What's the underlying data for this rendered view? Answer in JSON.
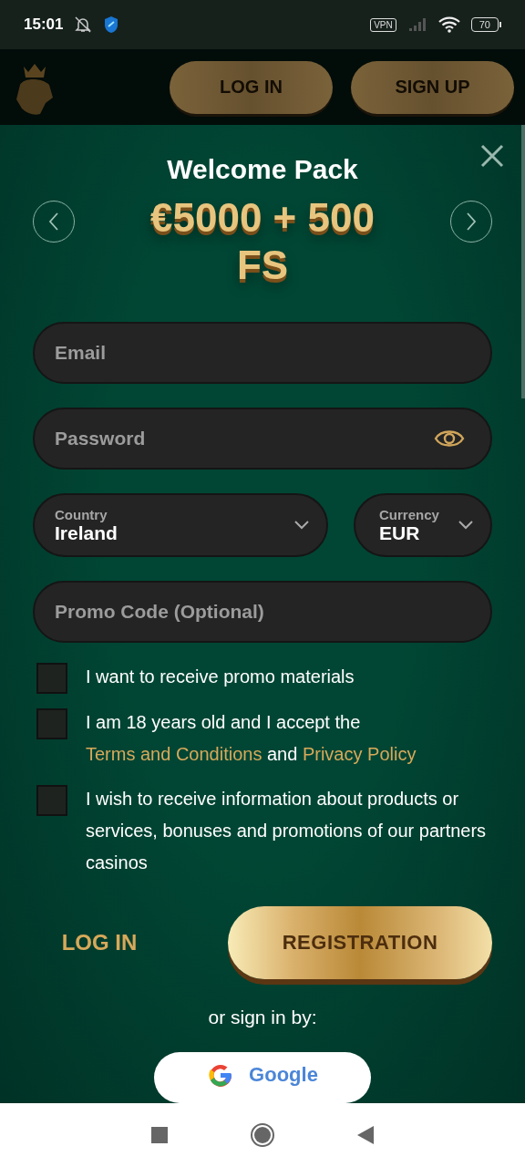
{
  "status_bar": {
    "time": "15:01",
    "vpn": "VPN",
    "battery": "70"
  },
  "header": {
    "buttons": [
      {
        "label": "LOG IN"
      },
      {
        "label": "SIGN UP"
      }
    ]
  },
  "modal": {
    "title": "Welcome Pack",
    "offer": "€5000 + 500 FS",
    "fields": [
      {
        "kind": "input",
        "placeholder": "Email"
      },
      {
        "kind": "password",
        "placeholder": "Password"
      }
    ],
    "selects": [
      {
        "label": "Country",
        "value": "Ireland"
      },
      {
        "label": "Currency",
        "value": "EUR"
      }
    ],
    "promo": {
      "placeholder": "Promo Code (Optional)"
    },
    "checkboxes": [
      {
        "checked": false,
        "parts": [
          {
            "kind": "text",
            "text": "I want to receive promo materials"
          }
        ]
      },
      {
        "checked": false,
        "parts": [
          {
            "kind": "text",
            "text": "I am 18 years old and I accept the "
          },
          {
            "kind": "link",
            "text": "Terms and Conditions"
          },
          {
            "kind": "text",
            "text": " and "
          },
          {
            "kind": "link",
            "text": "Privacy Policy"
          }
        ]
      },
      {
        "checked": false,
        "parts": [
          {
            "kind": "text",
            "text": "I wish to receive information about products or services, bonuses and promotions of our partners casinos"
          }
        ]
      }
    ],
    "login": "LOG IN",
    "register": "REGISTRATION",
    "or_text": "or sign in by:",
    "google": "Google"
  }
}
